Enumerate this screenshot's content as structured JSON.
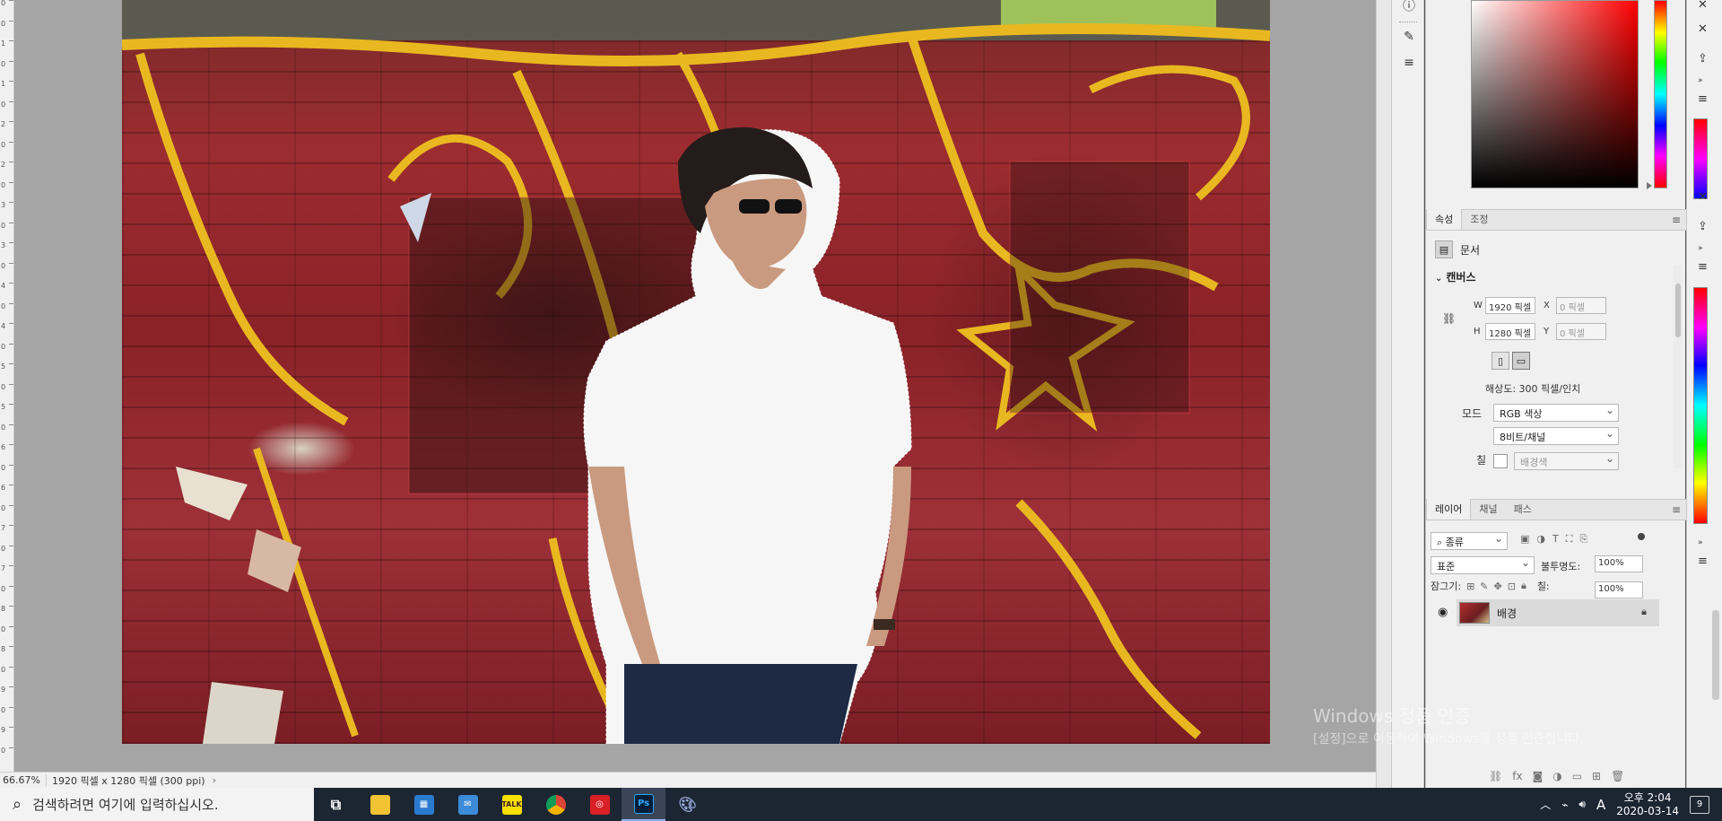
{
  "status_bar": {
    "zoom": "66.67%",
    "doc_info": "1920 픽셀 x 1280 픽셀 (300 ppi)"
  },
  "ruler": {
    "ticks": [
      "0",
      "0",
      "1",
      "0",
      "1",
      "0",
      "2",
      "0",
      "2",
      "0",
      "3",
      "0",
      "3",
      "0",
      "4",
      "0",
      "4",
      "0",
      "5",
      "0",
      "5",
      "0",
      "6",
      "0",
      "6",
      "0",
      "7",
      "0",
      "7",
      "0",
      "8",
      "0",
      "8",
      "0",
      "9",
      "0",
      "9",
      "0"
    ]
  },
  "properties_panel": {
    "tabs": [
      "속성",
      "조정"
    ],
    "doc_label": "문서",
    "section_title": "캔버스",
    "w_label": "W",
    "w_value": "1920 픽셀",
    "h_label": "H",
    "h_value": "1280 픽셀",
    "x_label": "X",
    "x_value": "0 픽셀",
    "y_label": "Y",
    "y_value": "0 픽셀",
    "resolution": "해상도: 300 픽셀/인치",
    "mode_label": "모드",
    "mode_value": "RGB 색상",
    "bit_depth": "8비트/채널",
    "fill_label": "칠",
    "fill_value": "배경색"
  },
  "layers_panel": {
    "tabs": [
      "레이어",
      "채널",
      "패스"
    ],
    "filter_kind": "종류",
    "blend_mode": "표준",
    "opacity_label": "불투명도:",
    "opacity_value": "100%",
    "lock_label": "잠그기:",
    "fill_label": "칠:",
    "fill_value": "100%",
    "layer_name": "배경"
  },
  "watermark": {
    "line1": "Windows 정품 인증",
    "line2": "[설정]으로 이동하여 Windows를 정품 인증합니다."
  },
  "taskbar": {
    "search_placeholder": "검색하려면 여기에 입력하십시오.",
    "time": "오후 2:04",
    "date": "2020-03-14",
    "notification_count": "9",
    "ime": "A",
    "kakao_label": "TALK",
    "ps_label": "Ps"
  },
  "colors": {
    "taskbar_bg": "#1c2633",
    "panel_bg": "#f0f0f0",
    "canvas_bg": "#a5a5a5"
  }
}
